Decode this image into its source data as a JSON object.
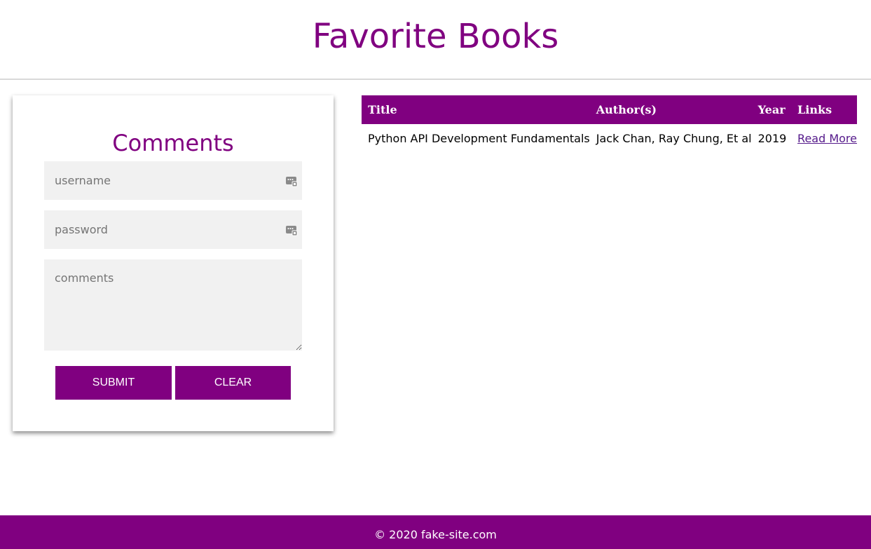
{
  "header": {
    "title": "Favorite Books"
  },
  "comments_form": {
    "title": "Comments",
    "username_placeholder": "username",
    "password_placeholder": "password",
    "comments_placeholder": "comments",
    "submit_label": "SUBMIT",
    "clear_label": "CLEAR"
  },
  "books_table": {
    "headers": [
      "Title",
      "Author(s)",
      "Year",
      "Links"
    ],
    "rows": [
      {
        "title": "Python API Development Fundamentals",
        "authors": "Jack Chan, Ray Chung, Et al",
        "year": "2019",
        "link_label": "Read More"
      }
    ]
  },
  "footer": {
    "text": "© 2020 fake-site.com"
  },
  "colors": {
    "brand": "#800080",
    "field_bg": "#f1f1f1",
    "link": "#551a8b"
  },
  "icons": {
    "field_icon": "password-manager-key-icon"
  }
}
